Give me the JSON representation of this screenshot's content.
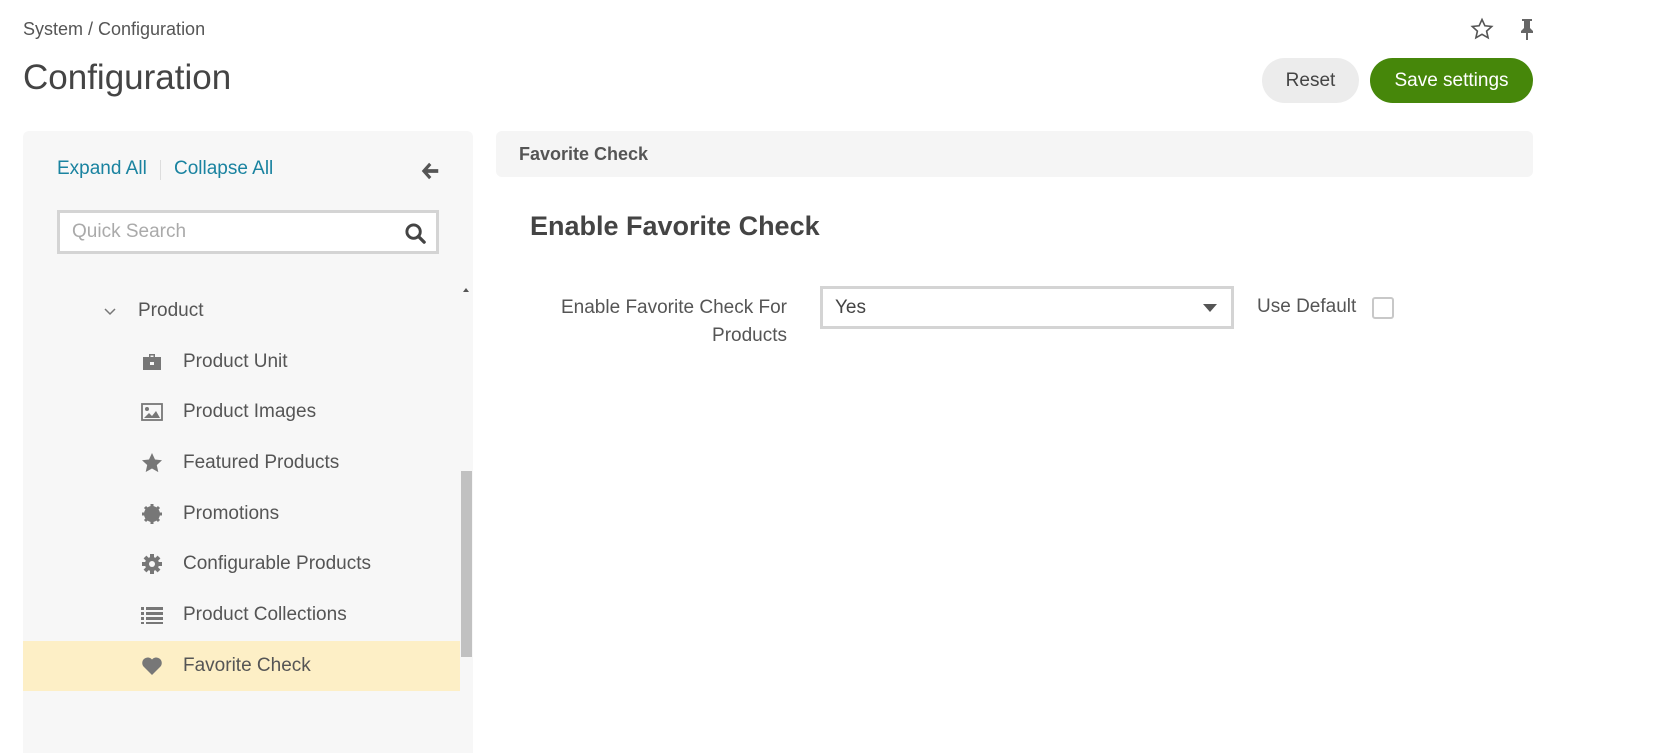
{
  "header": {
    "breadcrumb": "System / Configuration",
    "title": "Configuration",
    "reset_label": "Reset",
    "save_label": "Save settings"
  },
  "sidebar": {
    "expand_all": "Expand All",
    "collapse_all": "Collapse All",
    "search_placeholder": "Quick Search",
    "group": "Product",
    "items": [
      {
        "label": "Product Unit",
        "icon": "briefcase-icon"
      },
      {
        "label": "Product Images",
        "icon": "image-icon"
      },
      {
        "label": "Featured Products",
        "icon": "star-icon"
      },
      {
        "label": "Promotions",
        "icon": "badge-icon"
      },
      {
        "label": "Configurable Products",
        "icon": "gear-icon"
      },
      {
        "label": "Product Collections",
        "icon": "list-icon"
      },
      {
        "label": "Favorite Check",
        "icon": "heart-icon",
        "active": true
      }
    ]
  },
  "main": {
    "panel_title": "Favorite Check",
    "section_title": "Enable Favorite Check",
    "field_label": "Enable Favorite Check For Products",
    "field_value": "Yes",
    "use_default_label": "Use Default",
    "use_default_checked": false
  },
  "colors": {
    "accent": "#46870a",
    "link": "#1a83a0",
    "active_bg": "#fdefc6"
  }
}
